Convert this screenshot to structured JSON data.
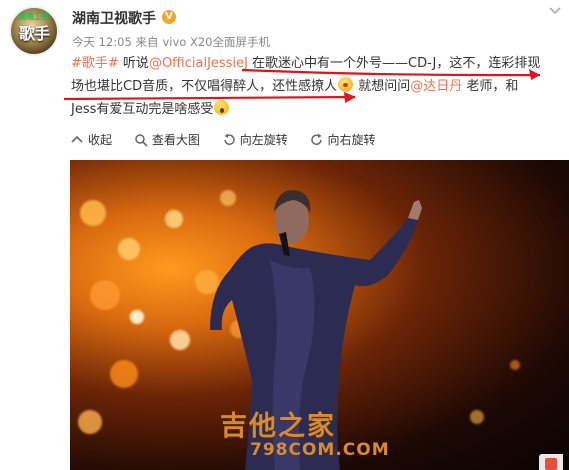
{
  "header": {
    "account_name": "湖南卫视歌手",
    "verified_badge": "V",
    "avatar_text_top": "湖南卫视",
    "avatar_text": "歌手",
    "more_icon": "chevron-down-icon"
  },
  "meta": {
    "time": "今天 12:05",
    "source_prefix": "来自",
    "source": "vivo X20全面屏手机"
  },
  "post": {
    "hashtag": "#歌手#",
    "text_1": " 听说",
    "mention_1": "@OfficialJessieJ",
    "text_2": " 在歌迷心中有一个外号——CD-J，这不，连彩排现",
    "text_3": "场也堪比CD音质，不仅唱得醉人，还性感撩人",
    "text_4": " 就想问问",
    "mention_2": "@达日丹",
    "text_5": " 老师，和",
    "text_6": "Jess有爱互动完是啥感受"
  },
  "toolbar": {
    "collapse": "收起",
    "view_large": "查看大图",
    "rotate_left": "向左旋转",
    "rotate_right": "向右旋转"
  },
  "image": {
    "watermark_cn": "吉他之家",
    "watermark_url": "798COM.COM"
  },
  "colors": {
    "link": "#eb7350",
    "annotation_arrow": "#e0141e"
  }
}
